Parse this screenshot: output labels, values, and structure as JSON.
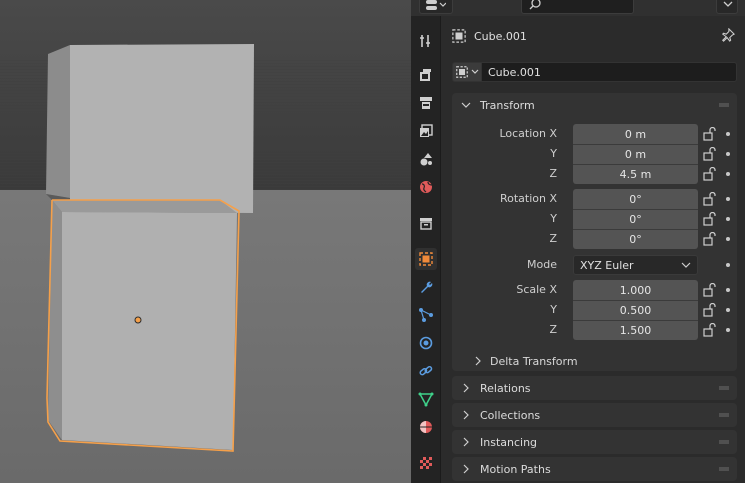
{
  "header": {
    "search_placeholder": ""
  },
  "context": {
    "object_name": "Cube.001"
  },
  "datablock": {
    "name": "Cube.001"
  },
  "transform": {
    "title": "Transform",
    "location": {
      "label_x": "Location X",
      "label_y": "Y",
      "label_z": "Z",
      "x": "0 m",
      "y": "0 m",
      "z": "4.5 m"
    },
    "rotation": {
      "label_x": "Rotation X",
      "label_y": "Y",
      "label_z": "Z",
      "x": "0°",
      "y": "0°",
      "z": "0°"
    },
    "mode": {
      "label": "Mode",
      "value": "XYZ Euler"
    },
    "scale": {
      "label_x": "Scale X",
      "label_y": "Y",
      "label_z": "Z",
      "x": "1.000",
      "y": "0.500",
      "z": "1.500"
    },
    "delta_title": "Delta Transform"
  },
  "panels": {
    "relations": "Relations",
    "collections": "Collections",
    "instancing": "Instancing",
    "motion_paths": "Motion Paths"
  },
  "colors": {
    "selection_outline": "#f5a04a",
    "active_tab_icon": "#f08a3a",
    "modifier_icon": "#5b9ce0",
    "data_icon": "#3fd18a",
    "material_icon": "#e05a5a"
  },
  "tabs": [
    "tool-icon",
    "render-icon",
    "output-icon",
    "view-layer-icon",
    "scene-icon",
    "world-icon",
    "collection-icon",
    "object-icon",
    "modifier-icon",
    "particles-icon",
    "physics-icon",
    "constraints-icon",
    "data-icon",
    "material-icon",
    "texture-icon"
  ]
}
